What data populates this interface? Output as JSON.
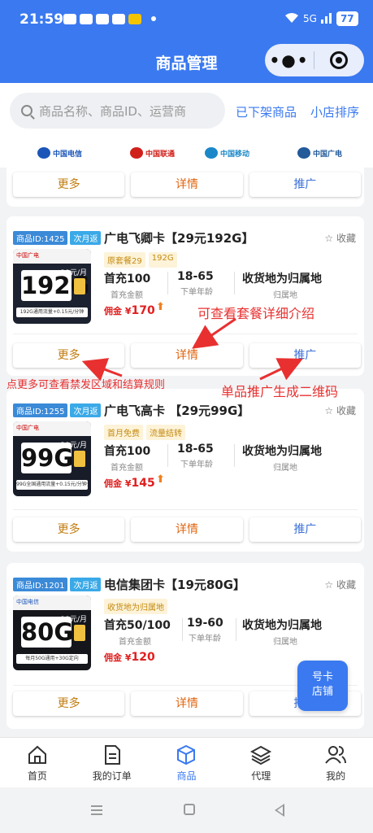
{
  "status": {
    "time": "21:59",
    "network": "5G",
    "battery": "77"
  },
  "nav": {
    "title": "商品管理"
  },
  "search": {
    "placeholder": "商品名称、商品ID、运营商",
    "offshelf": "已下架商品",
    "sort": "小店排序"
  },
  "carriers": [
    "中国电信",
    "中国联通",
    "中国移动",
    "中国广电"
  ],
  "top_buttons": {
    "more": "更多",
    "details": "详情",
    "promote": "推广"
  },
  "products": [
    {
      "id_label": "商品ID:1425",
      "settle": "次月返",
      "name": "广电飞卿卡【29元192G】",
      "fav": "收藏",
      "tags": [
        "原套餐29",
        "192G"
      ],
      "stats": [
        {
          "value": "首充100",
          "label": "首充金额"
        },
        {
          "value": "18-65",
          "label": "下单年龄"
        },
        {
          "value": "收货地为归属地",
          "label": "归属地"
        }
      ],
      "commission_label": "佣金 ¥",
      "commission": "170",
      "card_gb": "192G",
      "card_price": "29元/月",
      "card_brand": "中国广电",
      "card_sub": "192G通用流量+0.15元/分钟",
      "buttons": {
        "more": "更多",
        "details": "详情",
        "promote": "推广"
      }
    },
    {
      "id_label": "商品ID:1255",
      "settle": "次月返",
      "name": "广电飞高卡 【29元99G】",
      "fav": "收藏",
      "tags": [
        "首月免费",
        "流量结转"
      ],
      "stats": [
        {
          "value": "首充100",
          "label": "首充金额"
        },
        {
          "value": "18-65",
          "label": "下单年龄"
        },
        {
          "value": "收货地为归属地",
          "label": "归属地"
        }
      ],
      "commission_label": "佣金 ¥",
      "commission": "145",
      "card_gb": "99G",
      "card_price": "29元/月",
      "card_brand": "中国广电",
      "card_sub": "99G全国通用流量+0.15元/分钟全国通话",
      "buttons": {
        "more": "更多",
        "details": "详情",
        "promote": "推广"
      }
    },
    {
      "id_label": "商品ID:1201",
      "settle": "次月返",
      "name": "电信集团卡【19元80G】",
      "fav": "收藏",
      "tags": [
        "收货地为归属地"
      ],
      "stats": [
        {
          "value": "首充50/100",
          "label": "首充金额"
        },
        {
          "value": "19-60",
          "label": "下单年龄"
        },
        {
          "value": "收货地为归属地",
          "label": "归属地"
        }
      ],
      "commission_label": "佣金 ¥",
      "commission": "120",
      "card_gb": "80G",
      "card_price": "19元/月",
      "card_brand": "中国电信",
      "card_sub": "每月50G通用+30G定向",
      "buttons": {
        "more": "更多",
        "details": "详情",
        "promote": "推广"
      }
    }
  ],
  "annotations": {
    "details": "可查看套餐详细介绍",
    "more": "点更多可查看禁发区域和结算规则",
    "promote": "单品推广生成二维码"
  },
  "float_button": {
    "line1": "号卡",
    "line2": "店铺"
  },
  "tabs": [
    {
      "label": "首页",
      "icon": "home-icon"
    },
    {
      "label": "我的订单",
      "icon": "order-icon"
    },
    {
      "label": "商品",
      "icon": "box-icon"
    },
    {
      "label": "代理",
      "icon": "layers-icon"
    },
    {
      "label": "我的",
      "icon": "users-icon"
    }
  ],
  "colors": {
    "primary": "#3a79f0",
    "annotation": "#e83030",
    "commission": "#e02020"
  }
}
